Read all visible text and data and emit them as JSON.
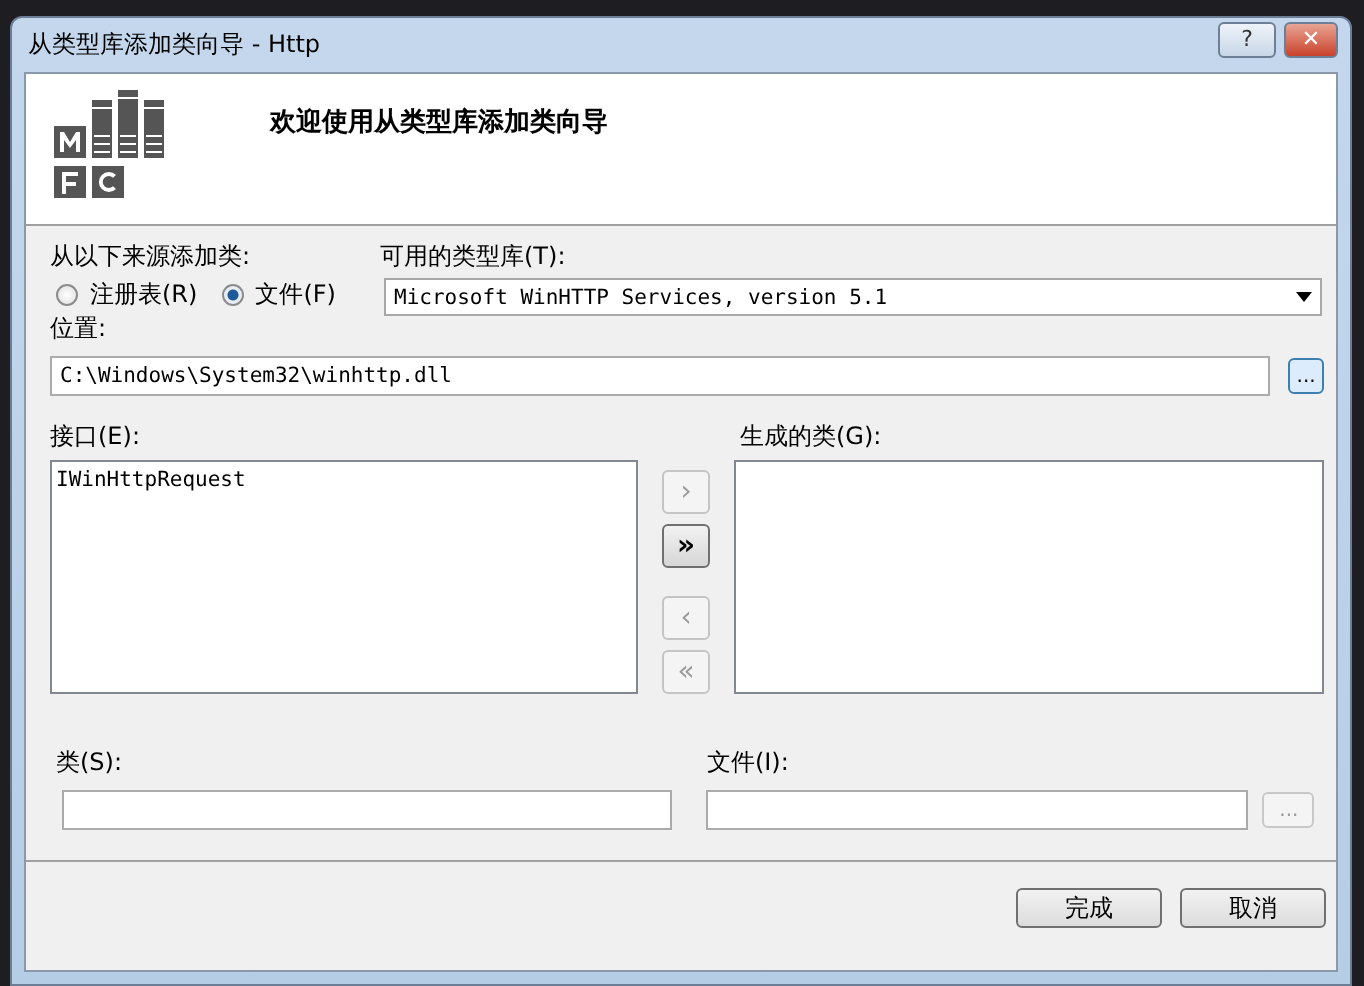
{
  "window": {
    "title": "从类型库添加类向导 - Http",
    "buttons": [
      {
        "kind": "help",
        "label": "?"
      },
      {
        "kind": "close",
        "label": "✕"
      }
    ]
  },
  "header": {
    "title": "欢迎使用从类型库添加类向导"
  },
  "source": {
    "label": "从以下来源添加类:",
    "options": [
      {
        "label": "注册表(R)",
        "selected": false
      },
      {
        "label": "文件(F)",
        "selected": true
      }
    ]
  },
  "typelib": {
    "label": "可用的类型库(T):",
    "value": "Microsoft WinHTTP Services, version 5.1"
  },
  "location": {
    "label": "位置:",
    "value": "C:\\Windows\\System32\\winhttp.dll",
    "browse": {
      "label": "...",
      "disabled": false
    }
  },
  "interfaces": {
    "label": "接口(E):",
    "items": [
      "IWinHttpRequest"
    ]
  },
  "move_buttons": [
    {
      "label": "›",
      "disabled": true
    },
    {
      "label": "»",
      "disabled": false
    },
    {
      "label": "‹",
      "disabled": true
    },
    {
      "label": "«",
      "disabled": true
    }
  ],
  "generated": {
    "label": "生成的类(G):"
  },
  "class_field": {
    "label": "类(S):"
  },
  "file_field": {
    "label": "文件(I):",
    "browse": {
      "label": "...",
      "disabled": true
    }
  },
  "footer_buttons": [
    "完成",
    "取消"
  ]
}
